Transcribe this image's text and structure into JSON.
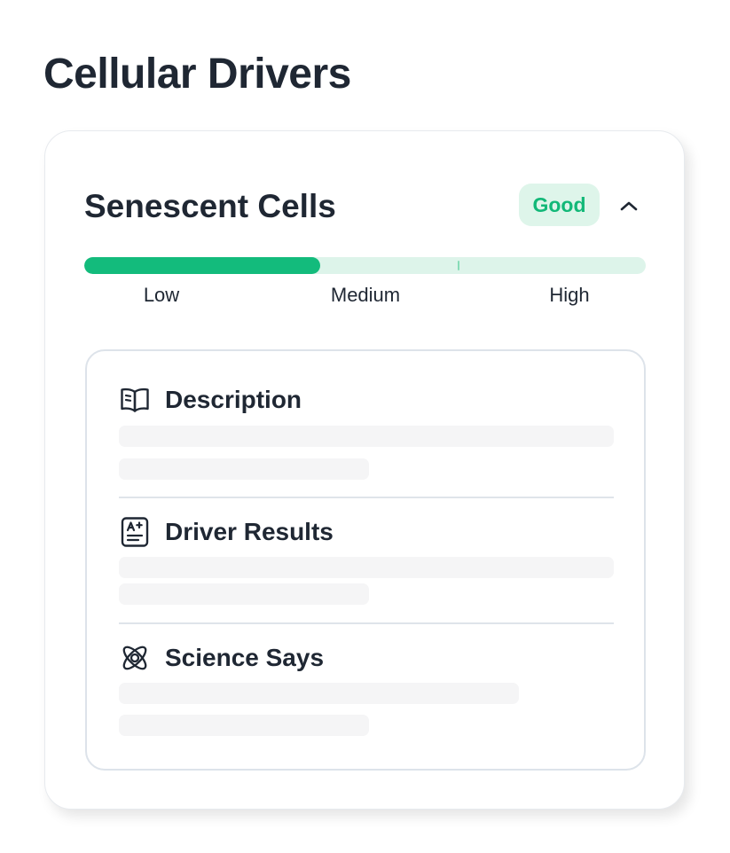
{
  "page": {
    "title": "Cellular Drivers"
  },
  "card": {
    "title": "Senescent Cells",
    "status": "Good",
    "status_colors": {
      "text": "#12b878",
      "background": "#def5ea"
    },
    "collapse_icon": "chevron-up-icon",
    "level": {
      "fraction": 0.42,
      "labels": [
        "Low",
        "Medium",
        "High"
      ],
      "fill_color": "#13bb7c",
      "track_color": "#ddf4ea"
    }
  },
  "sections": [
    {
      "title": "Description",
      "icon": "open-book-icon"
    },
    {
      "title": "Driver Results",
      "icon": "results-report-icon"
    },
    {
      "title": "Science Says",
      "icon": "atom-icon"
    }
  ]
}
